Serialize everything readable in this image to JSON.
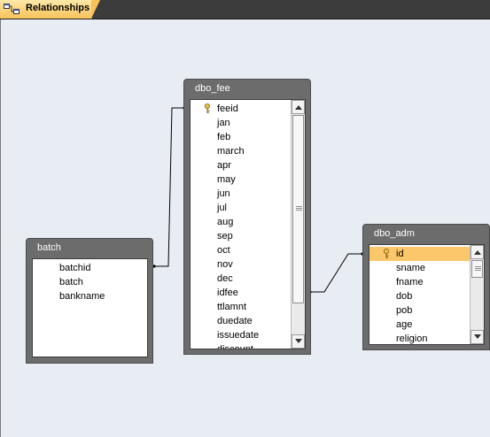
{
  "tab": {
    "label": "Relationships",
    "icon": "relationships-icon"
  },
  "tables": {
    "dbo_fee": {
      "name": "dbo_fee",
      "fields": [
        "feeid",
        "jan",
        "feb",
        "march",
        "apr",
        "may",
        "jun",
        "jul",
        "aug",
        "sep",
        "oct",
        "nov",
        "dec",
        "idfee",
        "ttlamnt",
        "duedate",
        "issuedate",
        "discount"
      ],
      "key_field": "feeid"
    },
    "batch": {
      "name": "batch",
      "fields": [
        "batchid",
        "batch",
        "bankname"
      ]
    },
    "dbo_adm": {
      "name": "dbo_adm",
      "fields": [
        "id",
        "sname",
        "fname",
        "dob",
        "pob",
        "age",
        "religion"
      ],
      "key_field": "id",
      "selected_field": "id"
    }
  },
  "colors": {
    "tab_bar": "#3c3c3c",
    "tab_active": "#f7c25a",
    "canvas": "#e8ecf3",
    "table_header": "#6c6c6c",
    "selected_row": "#fcc66a"
  }
}
